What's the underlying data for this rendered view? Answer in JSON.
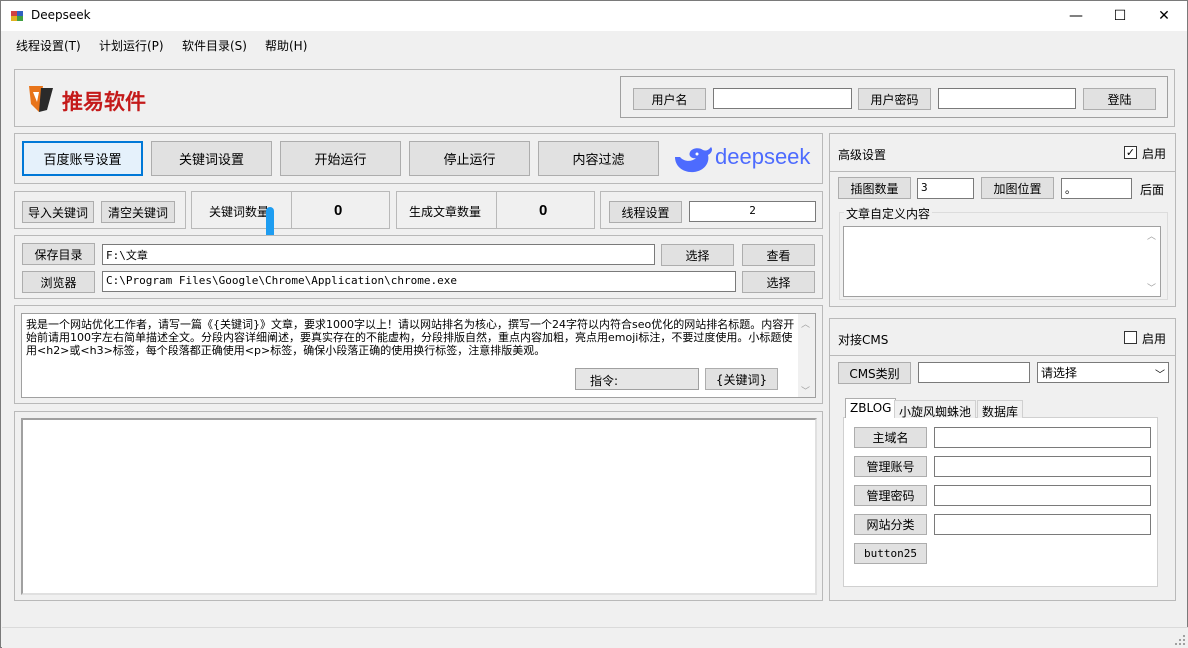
{
  "window": {
    "title": "Deepseek",
    "controls": {
      "minimize": "—",
      "maximize": "☐",
      "close": "✕"
    }
  },
  "menu": [
    "线程设置(T)",
    "计划运行(P)",
    "软件目录(S)",
    "帮助(H)"
  ],
  "header": {
    "logo_text": "推易软件",
    "username_label": "用户名",
    "username_value": "",
    "password_label": "用户密码",
    "password_value": "",
    "login_button": "登陆"
  },
  "toolbar": {
    "baidu_account": "百度账号设置",
    "keyword_settings": "关键词设置",
    "start": "开始运行",
    "stop": "停止运行",
    "content_filter": "内容过滤",
    "brand_logo_text": "deepseek"
  },
  "stats": {
    "import_keywords": "导入关键词",
    "clear_keywords": "清空关键词",
    "keyword_count_label": "关键词数量",
    "keyword_count": "0",
    "article_count_label": "生成文章数量",
    "article_count": "0",
    "thread_settings": "线程设置",
    "thread_value": "2"
  },
  "paths": {
    "save_dir_button": "保存目录",
    "save_dir_value": "F:\\文章",
    "choose_1": "选择",
    "view": "查看",
    "browser_button": "浏览器",
    "browser_value": "C:\\Program Files\\Google\\Chrome\\Application\\chrome.exe",
    "choose_2": "选择"
  },
  "prompt": {
    "text": "我是一个网站优化工作者，请写一篇《{关键词}》文章，要求1000字以上！请以网站排名为核心，撰写一个24字符以内符合seo优化的网站排名标题。内容开始前请用100字左右简单描述全文。分段内容详细阐述，要真实存在的不能虚构，分段排版自然，重点内容加粗，亮点用emoji标注，不要过度使用。小标题使用<h2>或<h3>标签，每个段落都正确使用<p>标签，确保小段落正确的使用换行标签，注意排版美观。",
    "command_label": "指令:",
    "keyword_token": "{关键词}"
  },
  "log": {
    "text": ""
  },
  "advanced": {
    "title": "高级设置",
    "enable_label": "启用",
    "enabled": true,
    "image_count_label": "插图数量",
    "image_count_value": "3",
    "image_position_label": "加图位置",
    "image_position_value": "。",
    "after_label": "后面",
    "custom_content_label": "文章自定义内容",
    "custom_content_value": ""
  },
  "cms": {
    "title": "对接CMS",
    "enable_label": "启用",
    "enabled": false,
    "category_button": "CMS类别",
    "category_input": "",
    "select_value": "请选择",
    "tabs": [
      "ZBLOG",
      "小旋风蜘蛛池",
      "数据库"
    ],
    "active_tab": 0,
    "domain_label": "主域名",
    "admin_account_label": "管理账号",
    "admin_password_label": "管理密码",
    "site_category_label": "网站分类",
    "button25": "button25"
  }
}
